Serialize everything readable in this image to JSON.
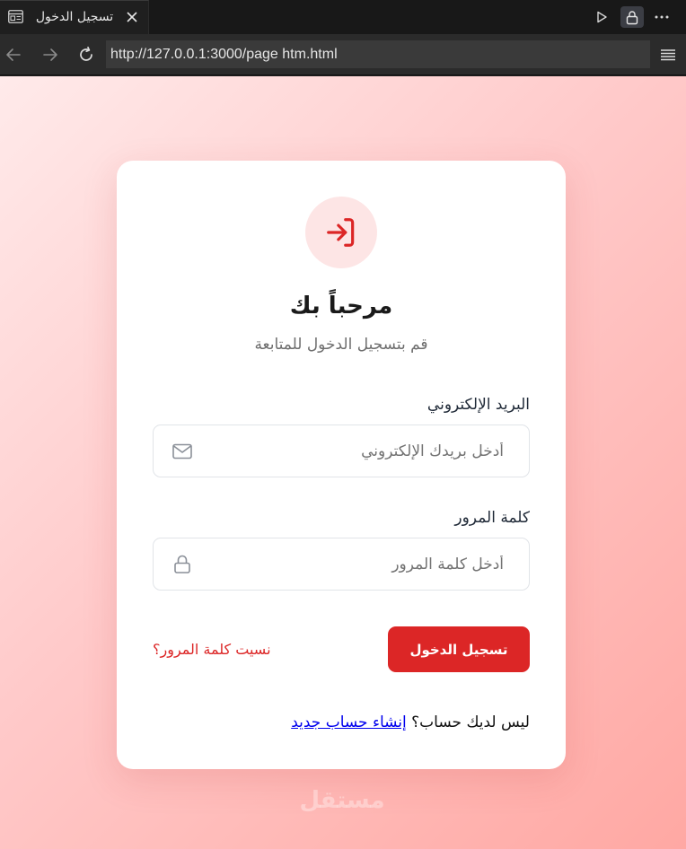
{
  "browser": {
    "tab_title": "تسجيل الدخول",
    "url": "http://127.0.0.1:3000/page htm.html",
    "icons": {
      "tab": "page-icon",
      "close": "close-icon",
      "play": "play-icon",
      "lock": "lock-icon",
      "more": "more-icon",
      "back": "arrow-left-icon",
      "forward": "arrow-right-icon",
      "reload": "reload-icon",
      "menu": "menu-icon"
    }
  },
  "login": {
    "icon": "login-icon",
    "title": "مرحباً بك",
    "subtitle": "قم بتسجيل الدخول للمتابعة",
    "email": {
      "label": "البريد الإلكتروني",
      "placeholder": "أدخل بريدك الإلكتروني",
      "value": "",
      "icon": "mail-icon"
    },
    "password": {
      "label": "كلمة المرور",
      "placeholder": "أدخل كلمة المرور",
      "value": "",
      "icon": "lock-icon"
    },
    "submit_label": "تسجيل الدخول",
    "forgot_label": "نسيت كلمة المرور؟",
    "no_account_text": "ليس لديك حساب؟",
    "signup_label": "إنشاء حساب جديد"
  },
  "watermark": "مستقل",
  "colors": {
    "accent": "#dc2626",
    "accent_soft": "#fde5e5",
    "link": "#0000ee",
    "card": "#ffffff"
  }
}
